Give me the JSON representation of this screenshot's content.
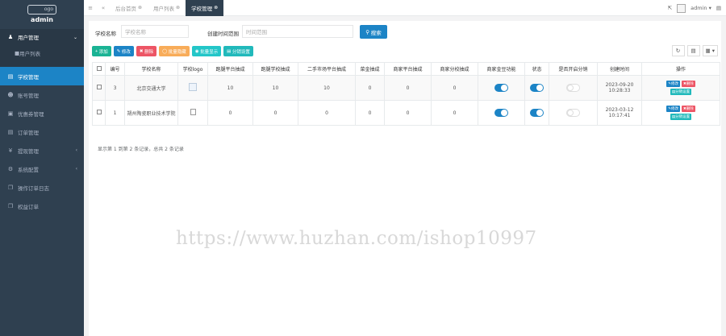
{
  "sidebar": {
    "logo_text": "admin",
    "logo_img_text": "ogo",
    "items": [
      {
        "label": "用户管理",
        "icon": "user-icon",
        "open": true,
        "arrow": "⌄"
      },
      {
        "label": "用户列表",
        "icon": "list-icon",
        "sub": true
      },
      {
        "label": "学校管理",
        "icon": "doc-icon",
        "active": true
      },
      {
        "label": "账号管理",
        "icon": "users-icon"
      },
      {
        "label": "优惠券管理",
        "icon": "ticket-icon"
      },
      {
        "label": "订单管理",
        "icon": "doc-icon"
      },
      {
        "label": "提现管理",
        "icon": "yen-icon",
        "arrow": "‹"
      },
      {
        "label": "系统配置",
        "icon": "gear-icon",
        "arrow": "‹"
      },
      {
        "label": "操作订单日志",
        "icon": "copy-icon"
      },
      {
        "label": "权益订单",
        "icon": "copy-icon"
      }
    ]
  },
  "topbar": {
    "tabs": [
      {
        "label": "后台首页",
        "active": false
      },
      {
        "label": "用户列表",
        "active": false
      },
      {
        "label": "学校管理",
        "active": true
      }
    ],
    "user": "admin",
    "close_glyph": "⊗"
  },
  "search": {
    "school_label": "学校名称",
    "school_placeholder": "学校名称",
    "time_label": "创建时间范围",
    "time_placeholder": "时间范围",
    "button": "搜索"
  },
  "toolbar": {
    "add": "添加",
    "edit": "修改",
    "delete": "删除",
    "batch_hide": "批量隐藏",
    "batch_show": "批量显示",
    "split_settings": "分销设置"
  },
  "table": {
    "headers": [
      "编号",
      "学校名称",
      "学校logo",
      "跑腿平台抽成",
      "跑腿学校抽成",
      "二手市场平台抽成",
      "菜金抽成",
      "商家平台抽成",
      "商家分校抽成",
      "商家金豆功能",
      "状态",
      "是否开启分销",
      "创建时间",
      "操作"
    ],
    "rows": [
      {
        "id": "3",
        "name": "北京交通大学",
        "logo": "image",
        "c1": "10",
        "c2": "10",
        "c3": "10",
        "c4": "0",
        "c5": "0",
        "c6": "0",
        "golden_bean": true,
        "status": true,
        "distribution": false,
        "created": "2023-09-20 10:28:33"
      },
      {
        "id": "1",
        "name": "朔州陶瓷职业技术学院",
        "logo": "broken",
        "c1": "0",
        "c2": "0",
        "c3": "0",
        "c4": "0",
        "c5": "0",
        "c6": "0",
        "golden_bean": true,
        "status": true,
        "distribution": false,
        "created": "2023-03-12 10:17:41"
      }
    ],
    "row_ops": {
      "edit": "修改",
      "delete": "删除",
      "split": "分销设置"
    }
  },
  "pager": "显示第 1 到第 2 条记录，总共 2 条记录",
  "watermark": "https://www.huzhan.com/ishop10997",
  "colors": {
    "sidebar": "#2f4050",
    "primary": "#1c84c6",
    "green": "#1ab394",
    "red": "#ed5565",
    "orange": "#f8ac59"
  }
}
